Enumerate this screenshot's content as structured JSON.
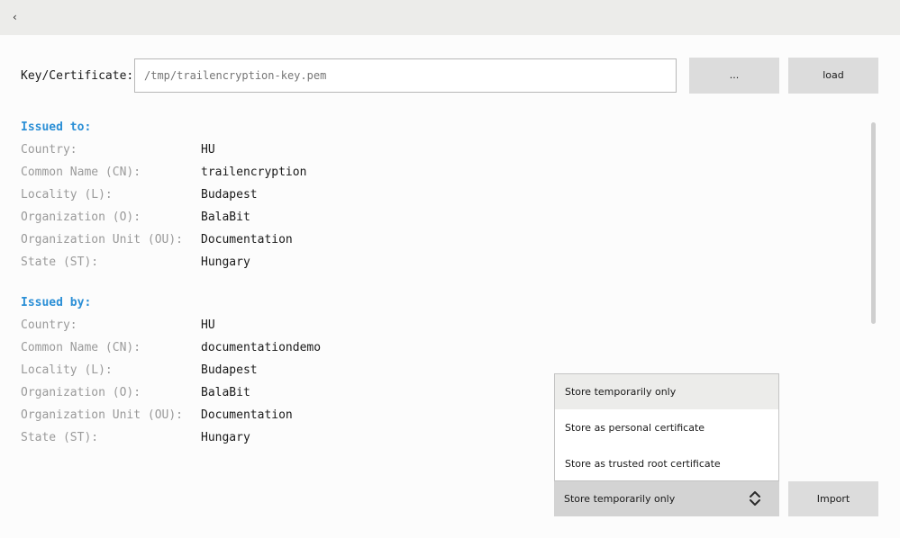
{
  "nav": {
    "back_glyph": "‹",
    "back_icon": "chevron-left-icon"
  },
  "key_cert": {
    "label": "Key/Certificate:",
    "placeholder": "/tmp/trailencryption-key.pem",
    "browse_label": "...",
    "load_label": "load"
  },
  "issued_to": {
    "title": "Issued to:",
    "fields": [
      {
        "key": "Country:",
        "value": "HU"
      },
      {
        "key": "Common Name (CN):",
        "value": "trailencryption"
      },
      {
        "key": "Locality (L):",
        "value": "Budapest"
      },
      {
        "key": "Organization (O):",
        "value": "BalaBit"
      },
      {
        "key": "Organization Unit (OU):",
        "value": "Documentation"
      },
      {
        "key": "State (ST):",
        "value": "Hungary"
      }
    ]
  },
  "issued_by": {
    "title": "Issued by:",
    "fields": [
      {
        "key": "Country:",
        "value": "HU"
      },
      {
        "key": "Common Name (CN):",
        "value": "documentationdemo"
      },
      {
        "key": "Locality (L):",
        "value": "Budapest"
      },
      {
        "key": "Organization (O):",
        "value": "BalaBit"
      },
      {
        "key": "Organization Unit (OU):",
        "value": "Documentation"
      },
      {
        "key": "State (ST):",
        "value": "Hungary"
      }
    ]
  },
  "store": {
    "options": [
      "Store temporarily only",
      "Store as personal certificate",
      "Store as trusted root certificate"
    ],
    "selected": "Store temporarily only",
    "chevron_icon": "up-down-chevron-icon"
  },
  "import_label": "Import",
  "colors": {
    "accent": "#2b8fd6",
    "topbar": "#ececea",
    "button": "#dcdcdc",
    "select": "#d3d3d3"
  }
}
